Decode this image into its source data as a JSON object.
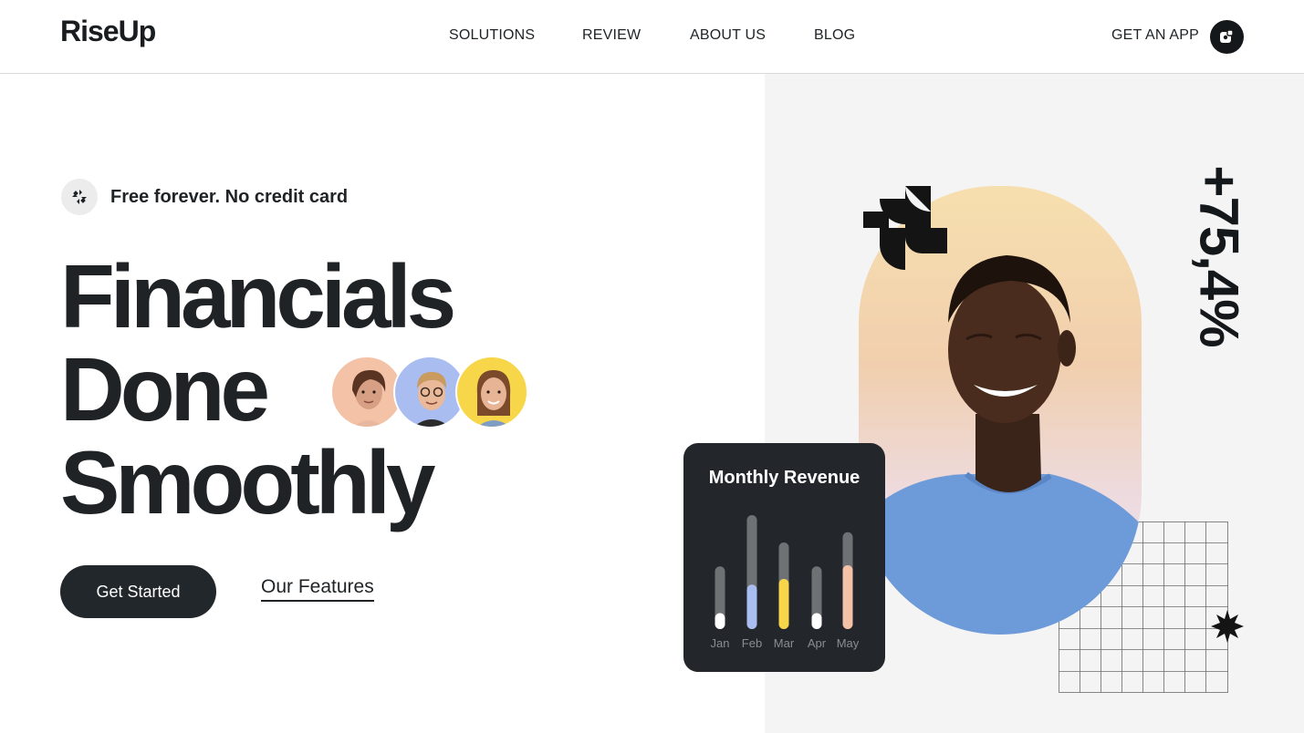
{
  "header": {
    "logo": "RiseUp",
    "nav": [
      "SOLUTIONS",
      "REVIEW",
      "ABOUT US",
      "BLOG"
    ],
    "get_app_label": "GET AN APP",
    "app_icon": "app-store-icon"
  },
  "hero": {
    "badge_text": "Free forever. No credit card",
    "badge_icon": "spinner-icon",
    "headline": [
      "Financials",
      "Done",
      "Smoothly"
    ],
    "primary_cta": "Get Started",
    "secondary_cta": "Our Features"
  },
  "stat": "+75,4%",
  "colors": {
    "dark": "#22272b",
    "accent_blue": "#a9bdf0",
    "accent_yellow": "#f8d64a",
    "accent_peach": "#f4c2a6",
    "shirt_blue": "#6d9ad8"
  },
  "revenue_card": {
    "title": "Monthly Revenue",
    "chart_data": {
      "type": "bar",
      "categories": [
        "Jan",
        "Feb",
        "Mar",
        "Apr",
        "May"
      ],
      "track": [
        0.55,
        1.0,
        0.76,
        0.55,
        0.85
      ],
      "values": [
        0.14,
        0.39,
        0.44,
        0.14,
        0.56
      ],
      "fill_colors": [
        "#ffffff",
        "#a9bdf0",
        "#f8d64a",
        "#ffffff",
        "#f4c2a6"
      ]
    }
  }
}
